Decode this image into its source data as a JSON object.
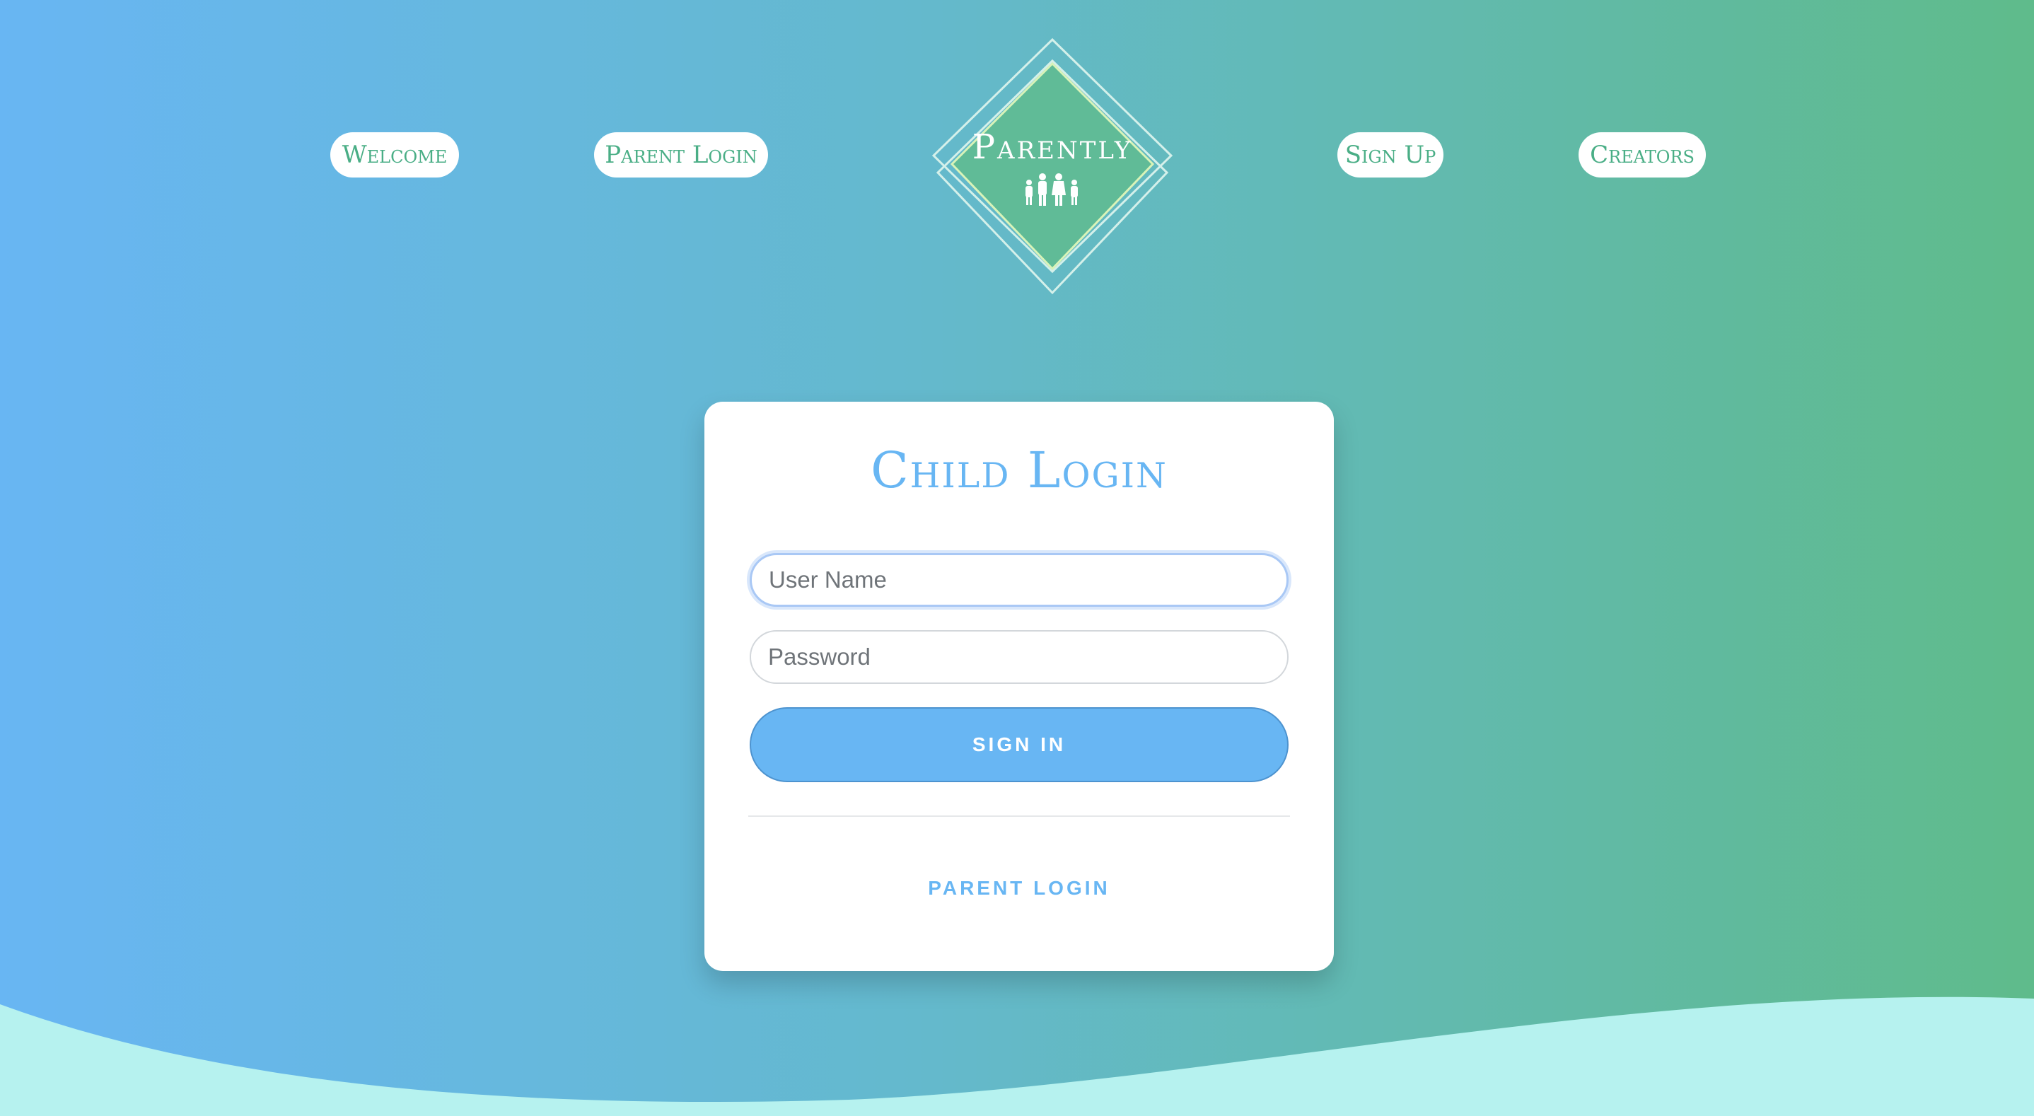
{
  "nav": {
    "welcome": "Welcome",
    "parent_login": "Parent Login",
    "sign_up": "Sign Up",
    "creators": "Creators"
  },
  "logo": {
    "text": "Parently",
    "icon": "family-icon"
  },
  "login_card": {
    "title": "Child Login",
    "username_placeholder": "User Name",
    "password_placeholder": "Password",
    "sign_in_label": "SIGN IN",
    "parent_login_link": "PARENT LOGIN"
  },
  "colors": {
    "gradient_left": "#68b6f3",
    "gradient_right": "#5fbb8b",
    "accent_blue": "#68b6f3",
    "accent_green": "#4aae86",
    "wave": "#b6f2ef"
  }
}
